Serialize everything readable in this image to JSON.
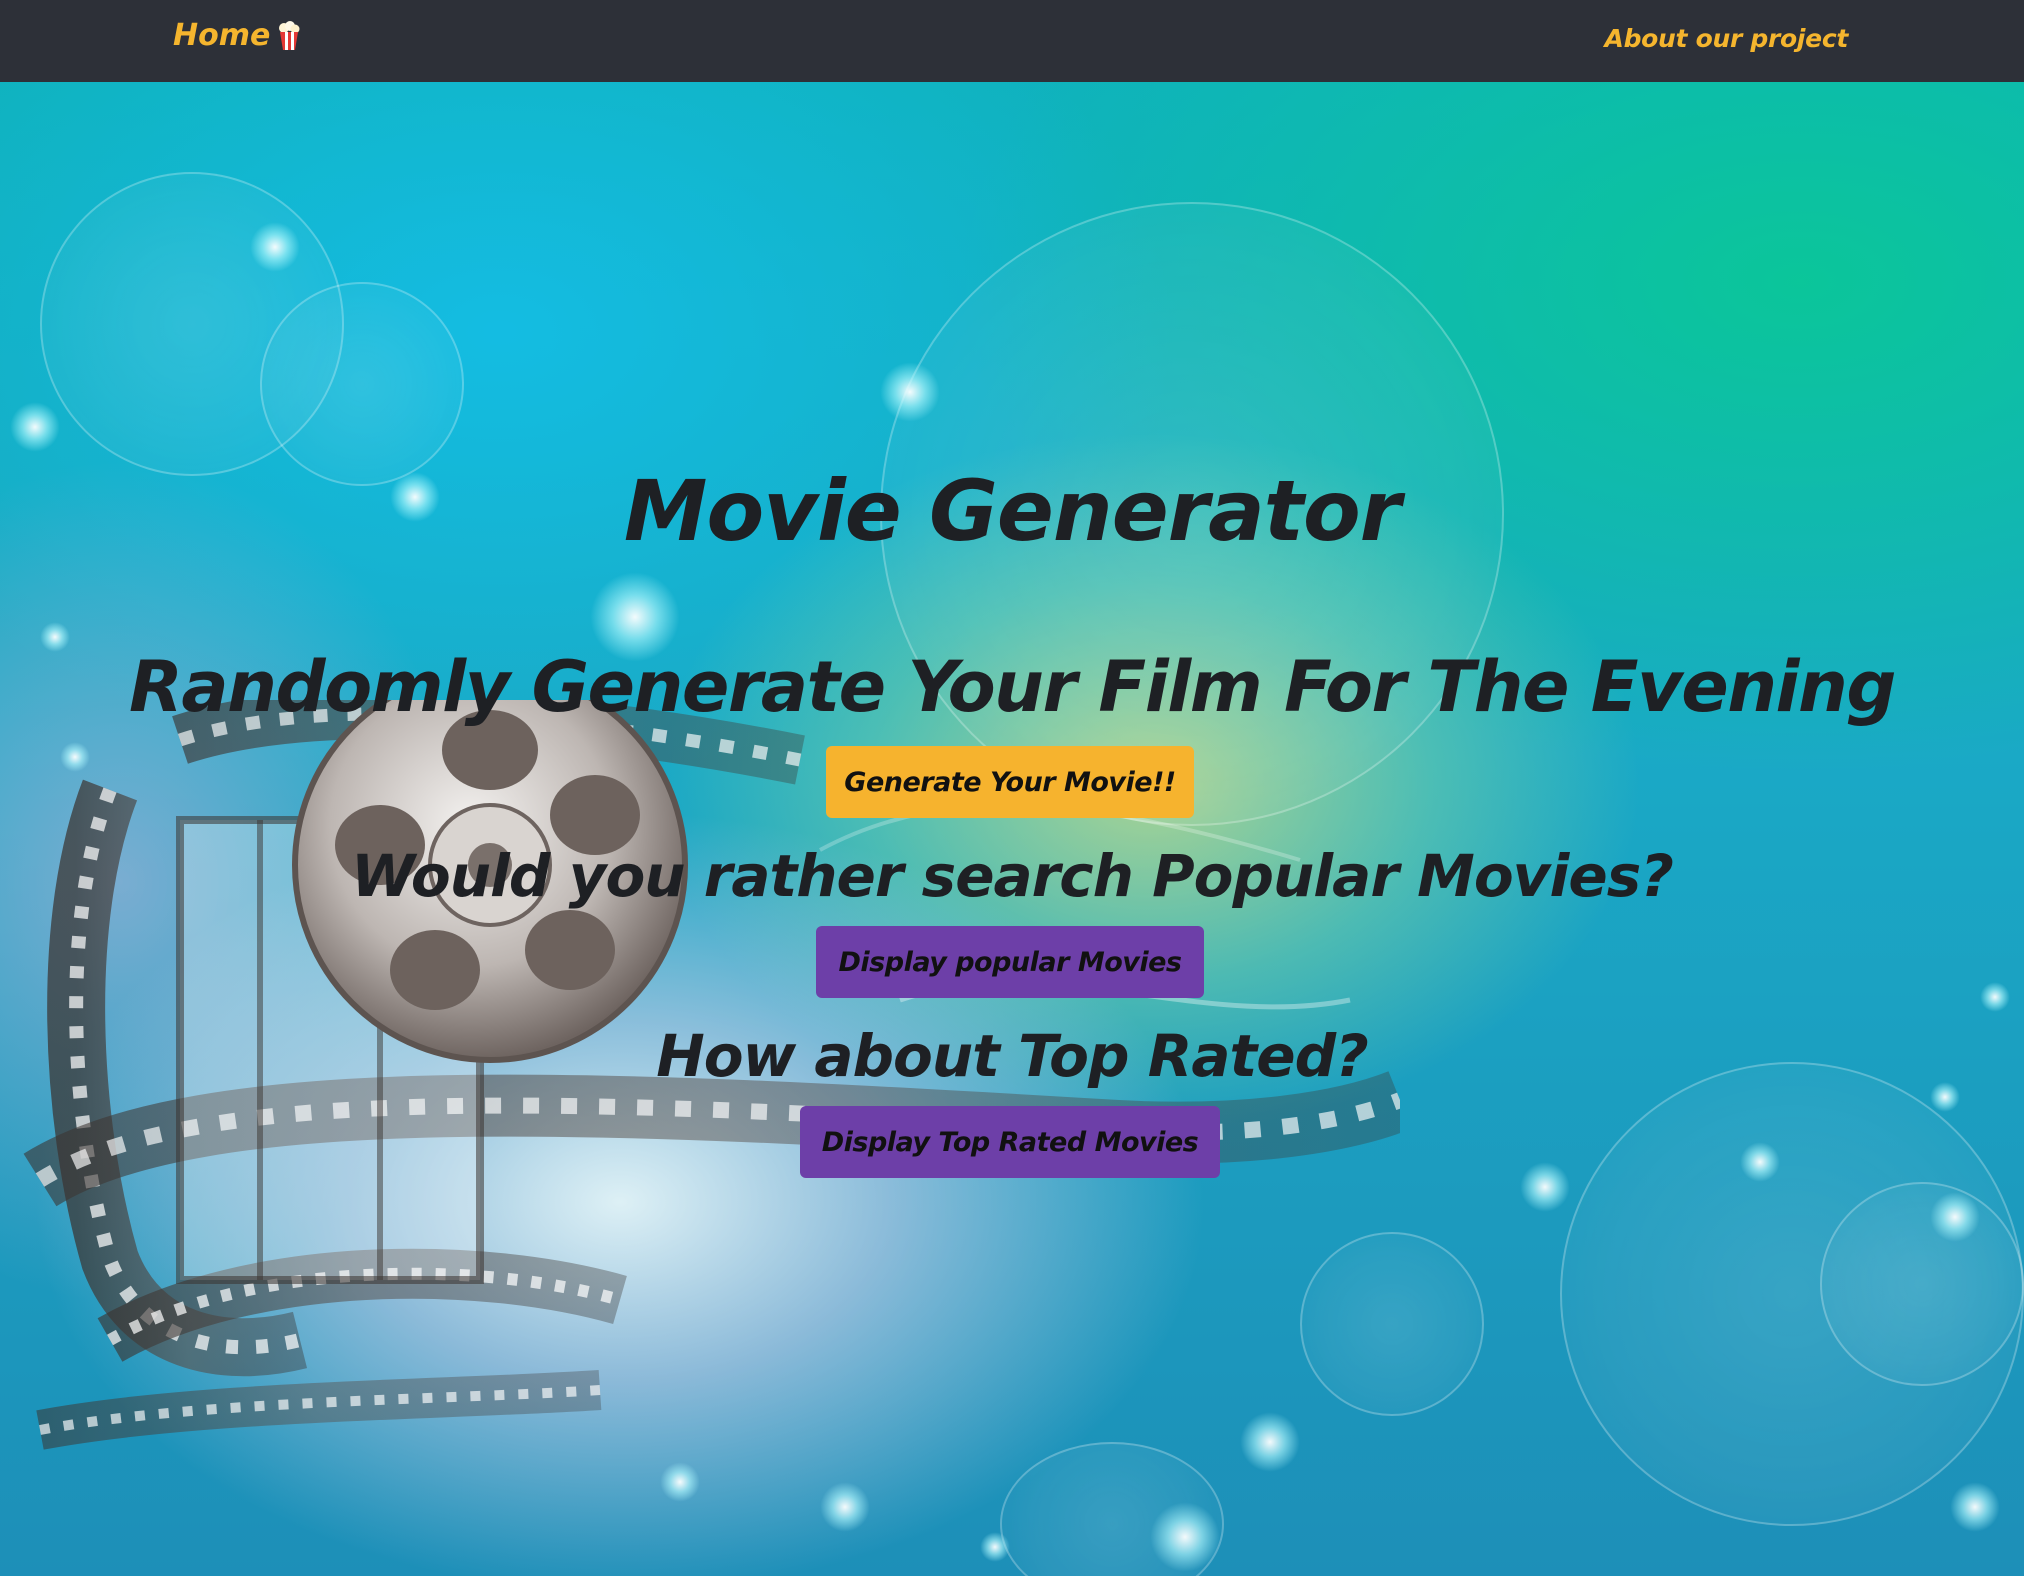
{
  "navbar": {
    "home_label": "Home",
    "home_icon": "popcorn-icon",
    "about_label": "About our project"
  },
  "main": {
    "title": "Movie Generator",
    "subtitle": "Randomly Generate Your Film For The Evening",
    "generate_button": "Generate Your Movie!!",
    "popular_heading": "Would you rather search Popular Movies?",
    "popular_button": "Display popular Movies",
    "toprated_heading": "How about Top Rated?",
    "toprated_button": "Display Top Rated Movies"
  },
  "colors": {
    "navbar_bg": "#2d3038",
    "nav_link": "#f5b52e",
    "generate_button_bg": "#f6b32e",
    "secondary_button_bg": "#6d3fa8",
    "heading_text": "#1e2024"
  }
}
